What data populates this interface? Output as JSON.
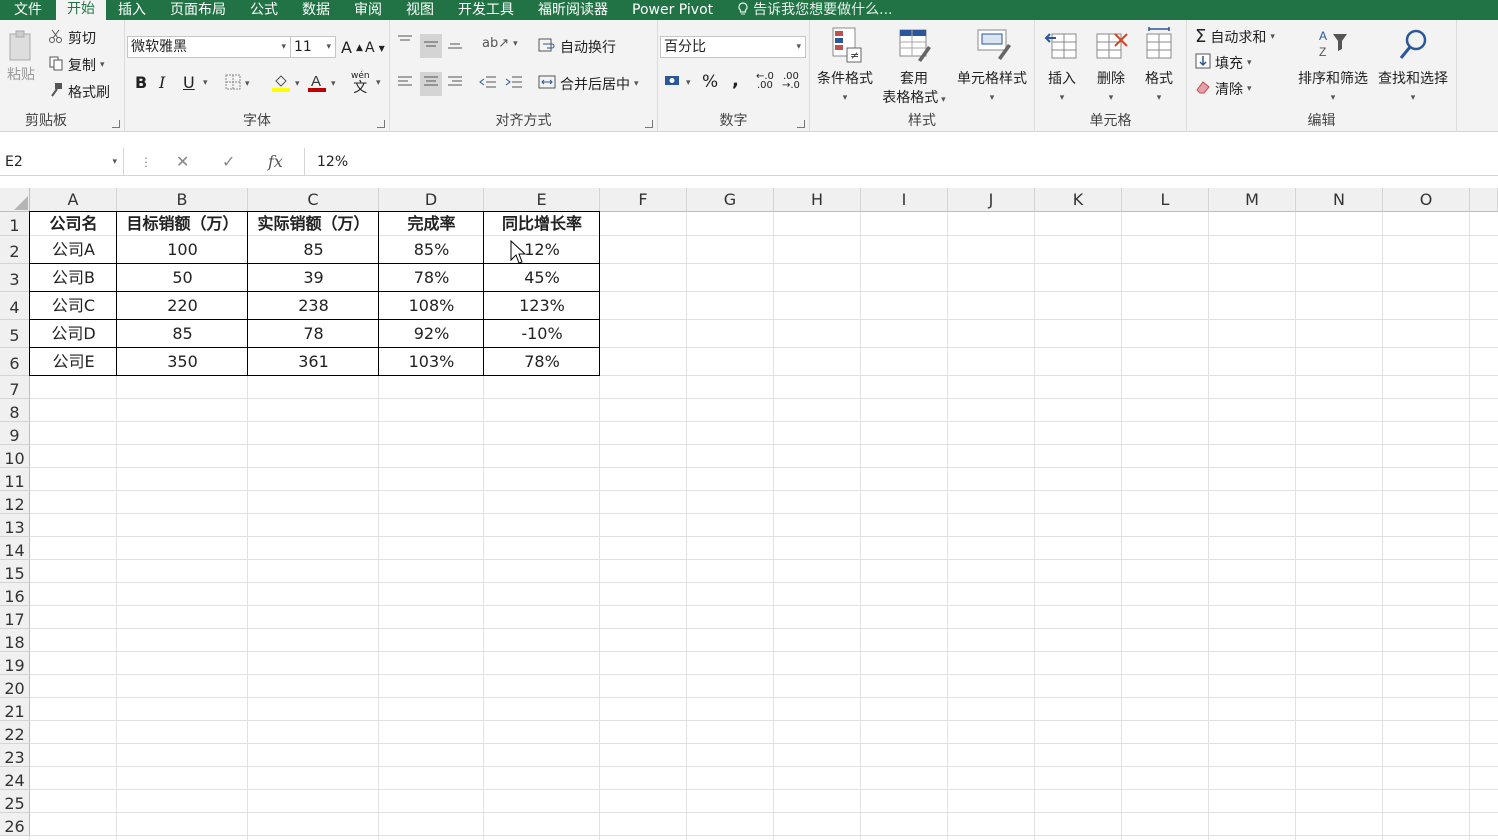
{
  "tabs": [
    "文件",
    "开始",
    "插入",
    "页面布局",
    "公式",
    "数据",
    "审阅",
    "视图",
    "开发工具",
    "福昕阅读器",
    "Power Pivot"
  ],
  "tell_me": "告诉我您想要做什么...",
  "clipboard": {
    "paste": "粘贴",
    "cut": "剪切",
    "copy": "复制",
    "painter": "格式刷",
    "label": "剪贴板"
  },
  "font": {
    "name": "微软雅黑",
    "size": "11",
    "label": "字体",
    "bold": "B",
    "italic": "I",
    "underline": "U",
    "wen": "wén",
    "wen_char": "文"
  },
  "alignment": {
    "wrap": "自动换行",
    "merge": "合并后居中",
    "label": "对齐方式"
  },
  "number": {
    "format": "百分比",
    "percent": "%",
    "comma": ",",
    "inc": ".00",
    "dec": ".0",
    "label": "数字"
  },
  "styles": {
    "conditional": "条件格式",
    "table_line1": "套用",
    "table_line2": "表格格式",
    "cell_styles": "单元格样式",
    "label": "样式"
  },
  "cells": {
    "insert": "插入",
    "delete": "删除",
    "format": "格式",
    "label": "单元格"
  },
  "editing": {
    "autosum": "自动求和",
    "fill": "填充",
    "clear": "清除",
    "sort": "排序和筛选",
    "find": "查找和选择",
    "label": "编辑"
  },
  "formula_bar": {
    "name_box": "E2",
    "fx": "fx",
    "value": "12%"
  },
  "columns": [
    "A",
    "B",
    "C",
    "D",
    "E",
    "F",
    "G",
    "H",
    "I",
    "J",
    "K",
    "L",
    "M",
    "N",
    "O"
  ],
  "rows": [
    "1",
    "2",
    "3",
    "4",
    "5",
    "6",
    "7",
    "8",
    "9",
    "10",
    "11",
    "12",
    "13",
    "14",
    "15",
    "16",
    "17",
    "18",
    "19",
    "20",
    "21",
    "22",
    "23",
    "24",
    "25",
    "26"
  ],
  "table": {
    "headers": [
      "公司名",
      "目标销额（万）",
      "实际销额（万）",
      "完成率",
      "同比增长率"
    ],
    "data": [
      [
        "公司A",
        "100",
        "85",
        "85%",
        "12%"
      ],
      [
        "公司B",
        "50",
        "39",
        "78%",
        "45%"
      ],
      [
        "公司C",
        "220",
        "238",
        "108%",
        "123%"
      ],
      [
        "公司D",
        "85",
        "78",
        "92%",
        "-10%"
      ],
      [
        "公司E",
        "350",
        "361",
        "103%",
        "78%"
      ]
    ]
  },
  "colors": {
    "excel_green": "#217346",
    "ribbon_bg": "#f3f3f3"
  }
}
